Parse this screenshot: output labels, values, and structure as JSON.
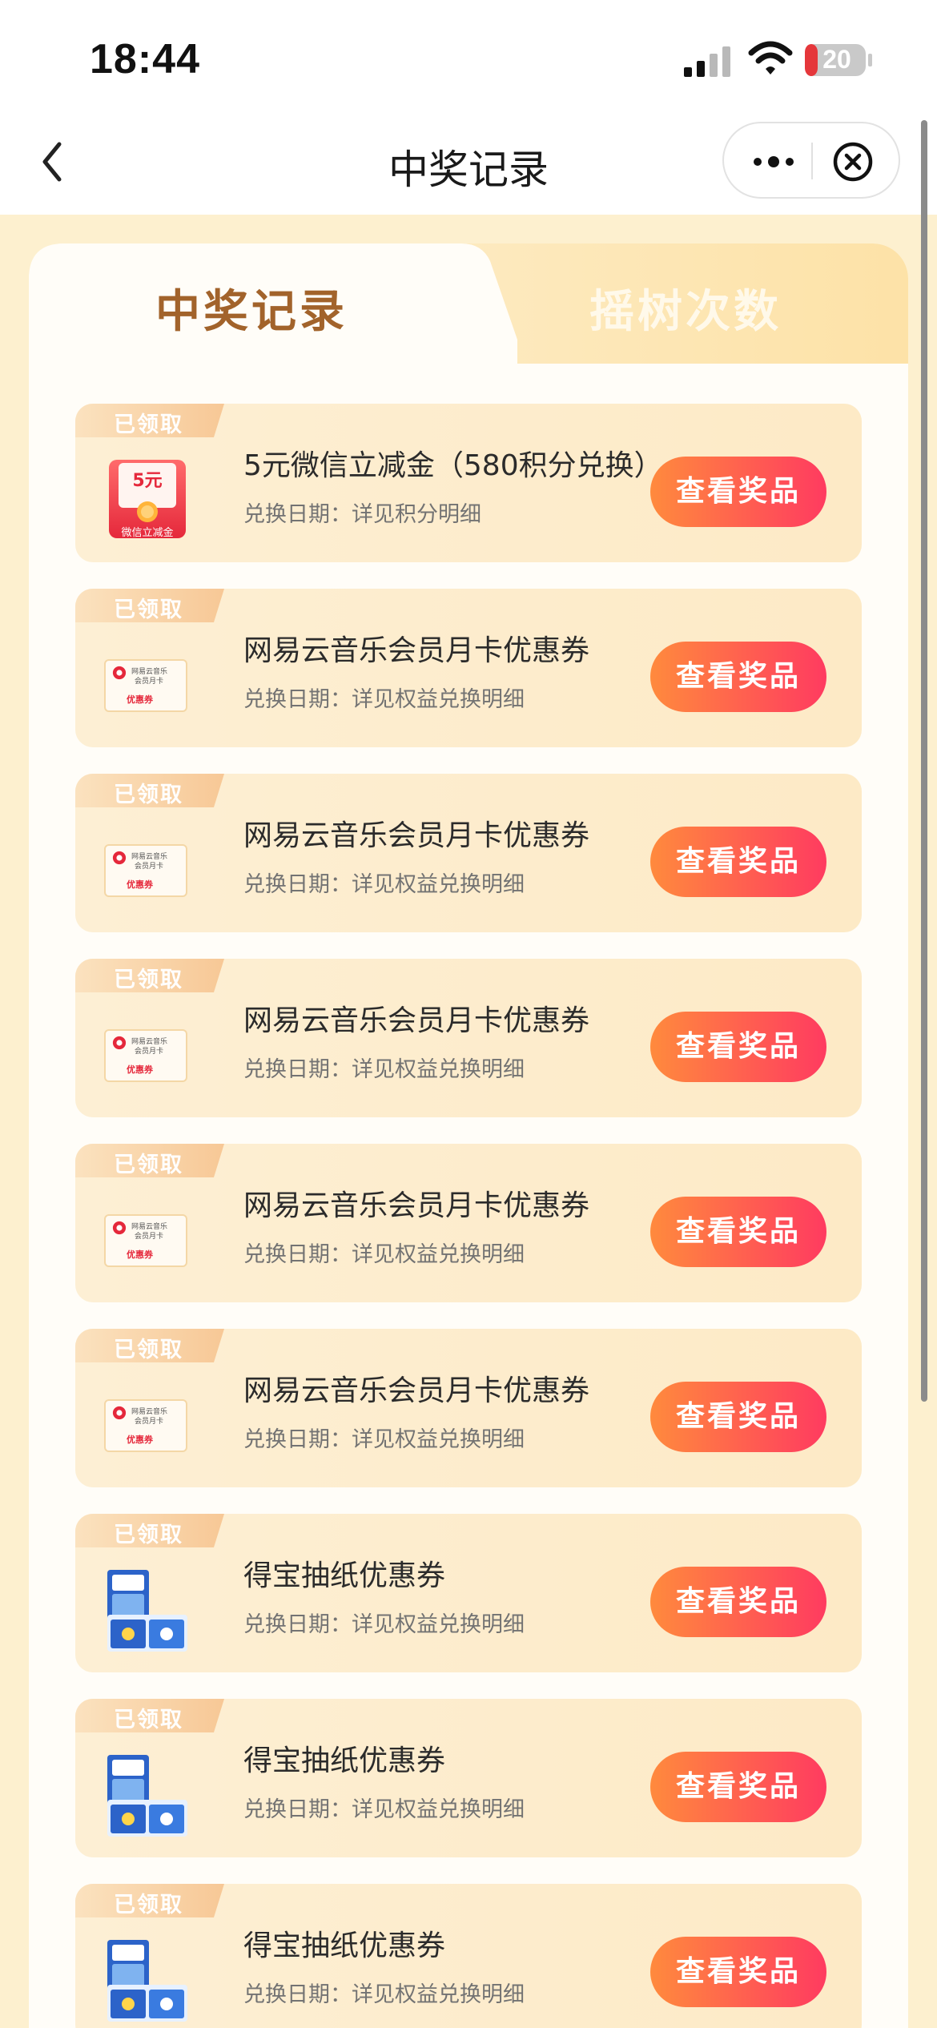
{
  "status_bar": {
    "time": "18:44",
    "battery_level": "20",
    "icons": [
      "signal-icon",
      "wifi-icon",
      "battery-icon"
    ]
  },
  "nav": {
    "title": "中奖记录",
    "icons": [
      "back-icon",
      "more-icon",
      "close-icon"
    ]
  },
  "tabs": [
    {
      "label": "中奖记录",
      "active": true
    },
    {
      "label": "摇树次数",
      "active": false
    }
  ],
  "records": [
    {
      "badge": "已领取",
      "title": "5元微信立减金（580积分兑换）",
      "date": "兑换日期：详见积分明细",
      "button": "查看奖品",
      "thumb": "wechat-coupon",
      "thumb_amount": "5元",
      "thumb_caption": "微信立减金"
    },
    {
      "badge": "已领取",
      "title": "网易云音乐会员月卡优惠券",
      "date": "兑换日期：详见权益兑换明细",
      "button": "查看奖品",
      "thumb": "music-coupon",
      "thumb_line1": "网易云音乐",
      "thumb_line2": "会员月卡",
      "thumb_caption": "优惠券"
    },
    {
      "badge": "已领取",
      "title": "网易云音乐会员月卡优惠券",
      "date": "兑换日期：详见权益兑换明细",
      "button": "查看奖品",
      "thumb": "music-coupon",
      "thumb_line1": "网易云音乐",
      "thumb_line2": "会员月卡",
      "thumb_caption": "优惠券"
    },
    {
      "badge": "已领取",
      "title": "网易云音乐会员月卡优惠券",
      "date": "兑换日期：详见权益兑换明细",
      "button": "查看奖品",
      "thumb": "music-coupon",
      "thumb_line1": "网易云音乐",
      "thumb_line2": "会员月卡",
      "thumb_caption": "优惠券"
    },
    {
      "badge": "已领取",
      "title": "网易云音乐会员月卡优惠券",
      "date": "兑换日期：详见权益兑换明细",
      "button": "查看奖品",
      "thumb": "music-coupon",
      "thumb_line1": "网易云音乐",
      "thumb_line2": "会员月卡",
      "thumb_caption": "优惠券"
    },
    {
      "badge": "已领取",
      "title": "网易云音乐会员月卡优惠券",
      "date": "兑换日期：详见权益兑换明细",
      "button": "查看奖品",
      "thumb": "music-coupon",
      "thumb_line1": "网易云音乐",
      "thumb_line2": "会员月卡",
      "thumb_caption": "优惠券"
    },
    {
      "badge": "已领取",
      "title": "得宝抽纸优惠券",
      "date": "兑换日期：详见权益兑换明细",
      "button": "查看奖品",
      "thumb": "tissue-pack"
    },
    {
      "badge": "已领取",
      "title": "得宝抽纸优惠券",
      "date": "兑换日期：详见权益兑换明细",
      "button": "查看奖品",
      "thumb": "tissue-pack"
    },
    {
      "badge": "已领取",
      "title": "得宝抽纸优惠券",
      "date": "兑换日期：详见权益兑换明细",
      "button": "查看奖品",
      "thumb": "tissue-pack"
    }
  ],
  "colors": {
    "page_bg": "#fdf0cf",
    "card_bg": "#fdefd4",
    "button_gradient_start": "#ff8a3d",
    "button_gradient_end": "#ff3b60",
    "active_tab_text": "#a2632b",
    "badge": "#f7c896"
  }
}
